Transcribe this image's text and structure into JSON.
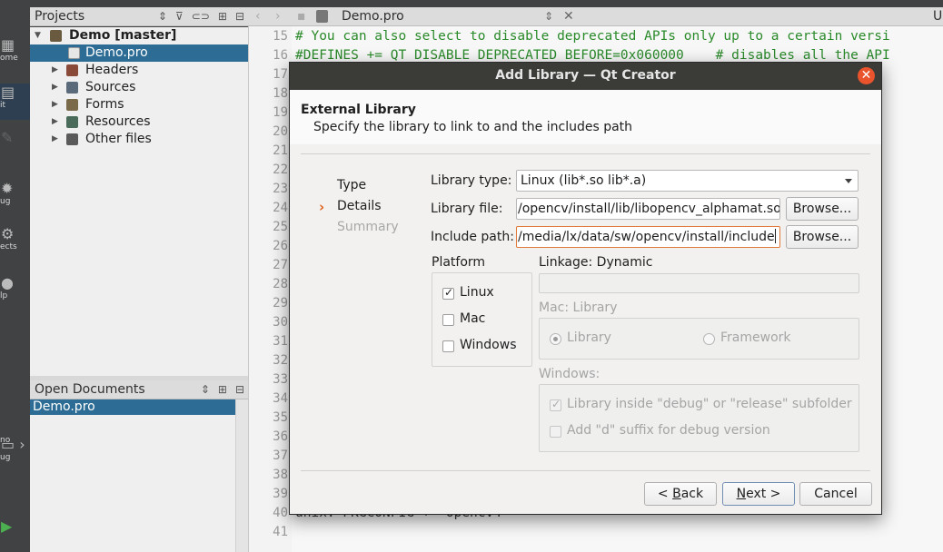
{
  "projects_pane": {
    "title": "Projects",
    "tree": [
      {
        "label": "Demo [master]",
        "level": 0,
        "expanded": true,
        "bold": true,
        "icon": "project-icon",
        "selected": false
      },
      {
        "label": "Demo.pro",
        "level": 1,
        "expanded": false,
        "bold": false,
        "icon": "pro-file-icon",
        "selected": true
      },
      {
        "label": "Headers",
        "level": 1,
        "expanded": false,
        "bold": false,
        "icon": "headers-folder-icon",
        "selected": false
      },
      {
        "label": "Sources",
        "level": 1,
        "expanded": false,
        "bold": false,
        "icon": "sources-folder-icon",
        "selected": false
      },
      {
        "label": "Forms",
        "level": 1,
        "expanded": false,
        "bold": false,
        "icon": "forms-folder-icon",
        "selected": false
      },
      {
        "label": "Resources",
        "level": 1,
        "expanded": false,
        "bold": false,
        "icon": "resources-folder-icon",
        "selected": false
      },
      {
        "label": "Other files",
        "level": 1,
        "expanded": false,
        "bold": false,
        "icon": "other-files-folder-icon",
        "selected": false
      }
    ]
  },
  "open_documents": {
    "title": "Open Documents",
    "items": [
      "Demo.pro"
    ]
  },
  "editor": {
    "file_name": "Demo.pro",
    "right_label": "U",
    "lines": [
      {
        "n": "15",
        "text": "# You can also select to disable deprecated APIs only up to a certain versi"
      },
      {
        "n": "16",
        "text": "#DEFINES += QT_DISABLE_DEPRECATED_BEFORE=0x060000    # disables all the API"
      },
      {
        "n": "17",
        "text": ""
      },
      {
        "n": "18",
        "text": ""
      },
      {
        "n": "19",
        "text": ""
      },
      {
        "n": "20",
        "text": ""
      },
      {
        "n": "21",
        "text": ""
      },
      {
        "n": "22",
        "text": ""
      },
      {
        "n": "23",
        "text": ""
      },
      {
        "n": "24",
        "text": ""
      },
      {
        "n": "25",
        "text": ""
      },
      {
        "n": "26",
        "text": ""
      },
      {
        "n": "27",
        "text": ""
      },
      {
        "n": "28",
        "text": ""
      },
      {
        "n": "29",
        "text": ""
      },
      {
        "n": "30",
        "text": ""
      },
      {
        "n": "31",
        "text": ""
      },
      {
        "n": "32",
        "text": ""
      },
      {
        "n": "33",
        "text": ""
      },
      {
        "n": "34",
        "text": ""
      },
      {
        "n": "35",
        "text": ""
      },
      {
        "n": "36",
        "text": ""
      },
      {
        "n": "37",
        "text": ""
      },
      {
        "n": "38",
        "text": ""
      },
      {
        "n": "39",
        "text": ""
      },
      {
        "n": "40",
        "text": "unix: PKGCONFIG += opencv4"
      },
      {
        "n": "41",
        "text": ""
      }
    ]
  },
  "modebar": {
    "items": [
      {
        "label": "ome",
        "icon": "home-grid-icon"
      },
      {
        "label": "it",
        "icon": "edit-icon",
        "active": true
      },
      {
        "label": "",
        "icon": "design-icon"
      },
      {
        "label": "ug",
        "icon": "debug-icon"
      },
      {
        "label": "ects",
        "icon": "projects-icon"
      },
      {
        "label": "lp",
        "icon": "help-icon"
      },
      {
        "label": "no",
        "icon": "kit-selector-icon"
      },
      {
        "label": "ug",
        "icon": "build-debug-icon"
      }
    ]
  },
  "dialog": {
    "title": "Add Library — Qt Creator",
    "page_title": "External Library",
    "page_subtitle": "Specify the library to link to and the includes path",
    "steps": [
      {
        "label": "Type",
        "state": "done"
      },
      {
        "label": "Details",
        "state": "current"
      },
      {
        "label": "Summary",
        "state": "todo"
      }
    ],
    "library_type": {
      "label": "Library type:",
      "value": "Linux (lib*.so lib*.a)"
    },
    "library_file": {
      "label": "Library file:",
      "value": "/opencv/install/lib/libopencv_alphamat.so"
    },
    "include_path": {
      "label": "Include path:",
      "value": "/media/lx/data/sw/opencv/install/include"
    },
    "browse_label": "Browse...",
    "platform": {
      "title": "Platform",
      "options": [
        {
          "label": "Linux",
          "checked": true
        },
        {
          "label": "Mac",
          "checked": false
        },
        {
          "label": "Windows",
          "checked": false
        }
      ]
    },
    "linkage": {
      "label": "Linkage: Dynamic",
      "value": ""
    },
    "mac": {
      "title": "Mac: Library",
      "options": [
        {
          "label": "Library",
          "selected": true
        },
        {
          "label": "Framework",
          "selected": false
        }
      ]
    },
    "windows": {
      "title": "Windows:",
      "options": [
        {
          "label": "Library inside \"debug\" or \"release\" subfolder",
          "checked": true
        },
        {
          "label": "Add \"d\" suffix for debug version",
          "checked": false
        }
      ]
    },
    "buttons": {
      "back": {
        "pre": "< ",
        "accel": "B",
        "post": "ack"
      },
      "next": {
        "accel": "N",
        "post": "ext >"
      },
      "cancel": "Cancel"
    }
  },
  "colors": {
    "selection": "#2c6c95",
    "close_button": "#e9542c",
    "step_arrow": "#e0621b",
    "comment_green": "#2a8a2a"
  }
}
